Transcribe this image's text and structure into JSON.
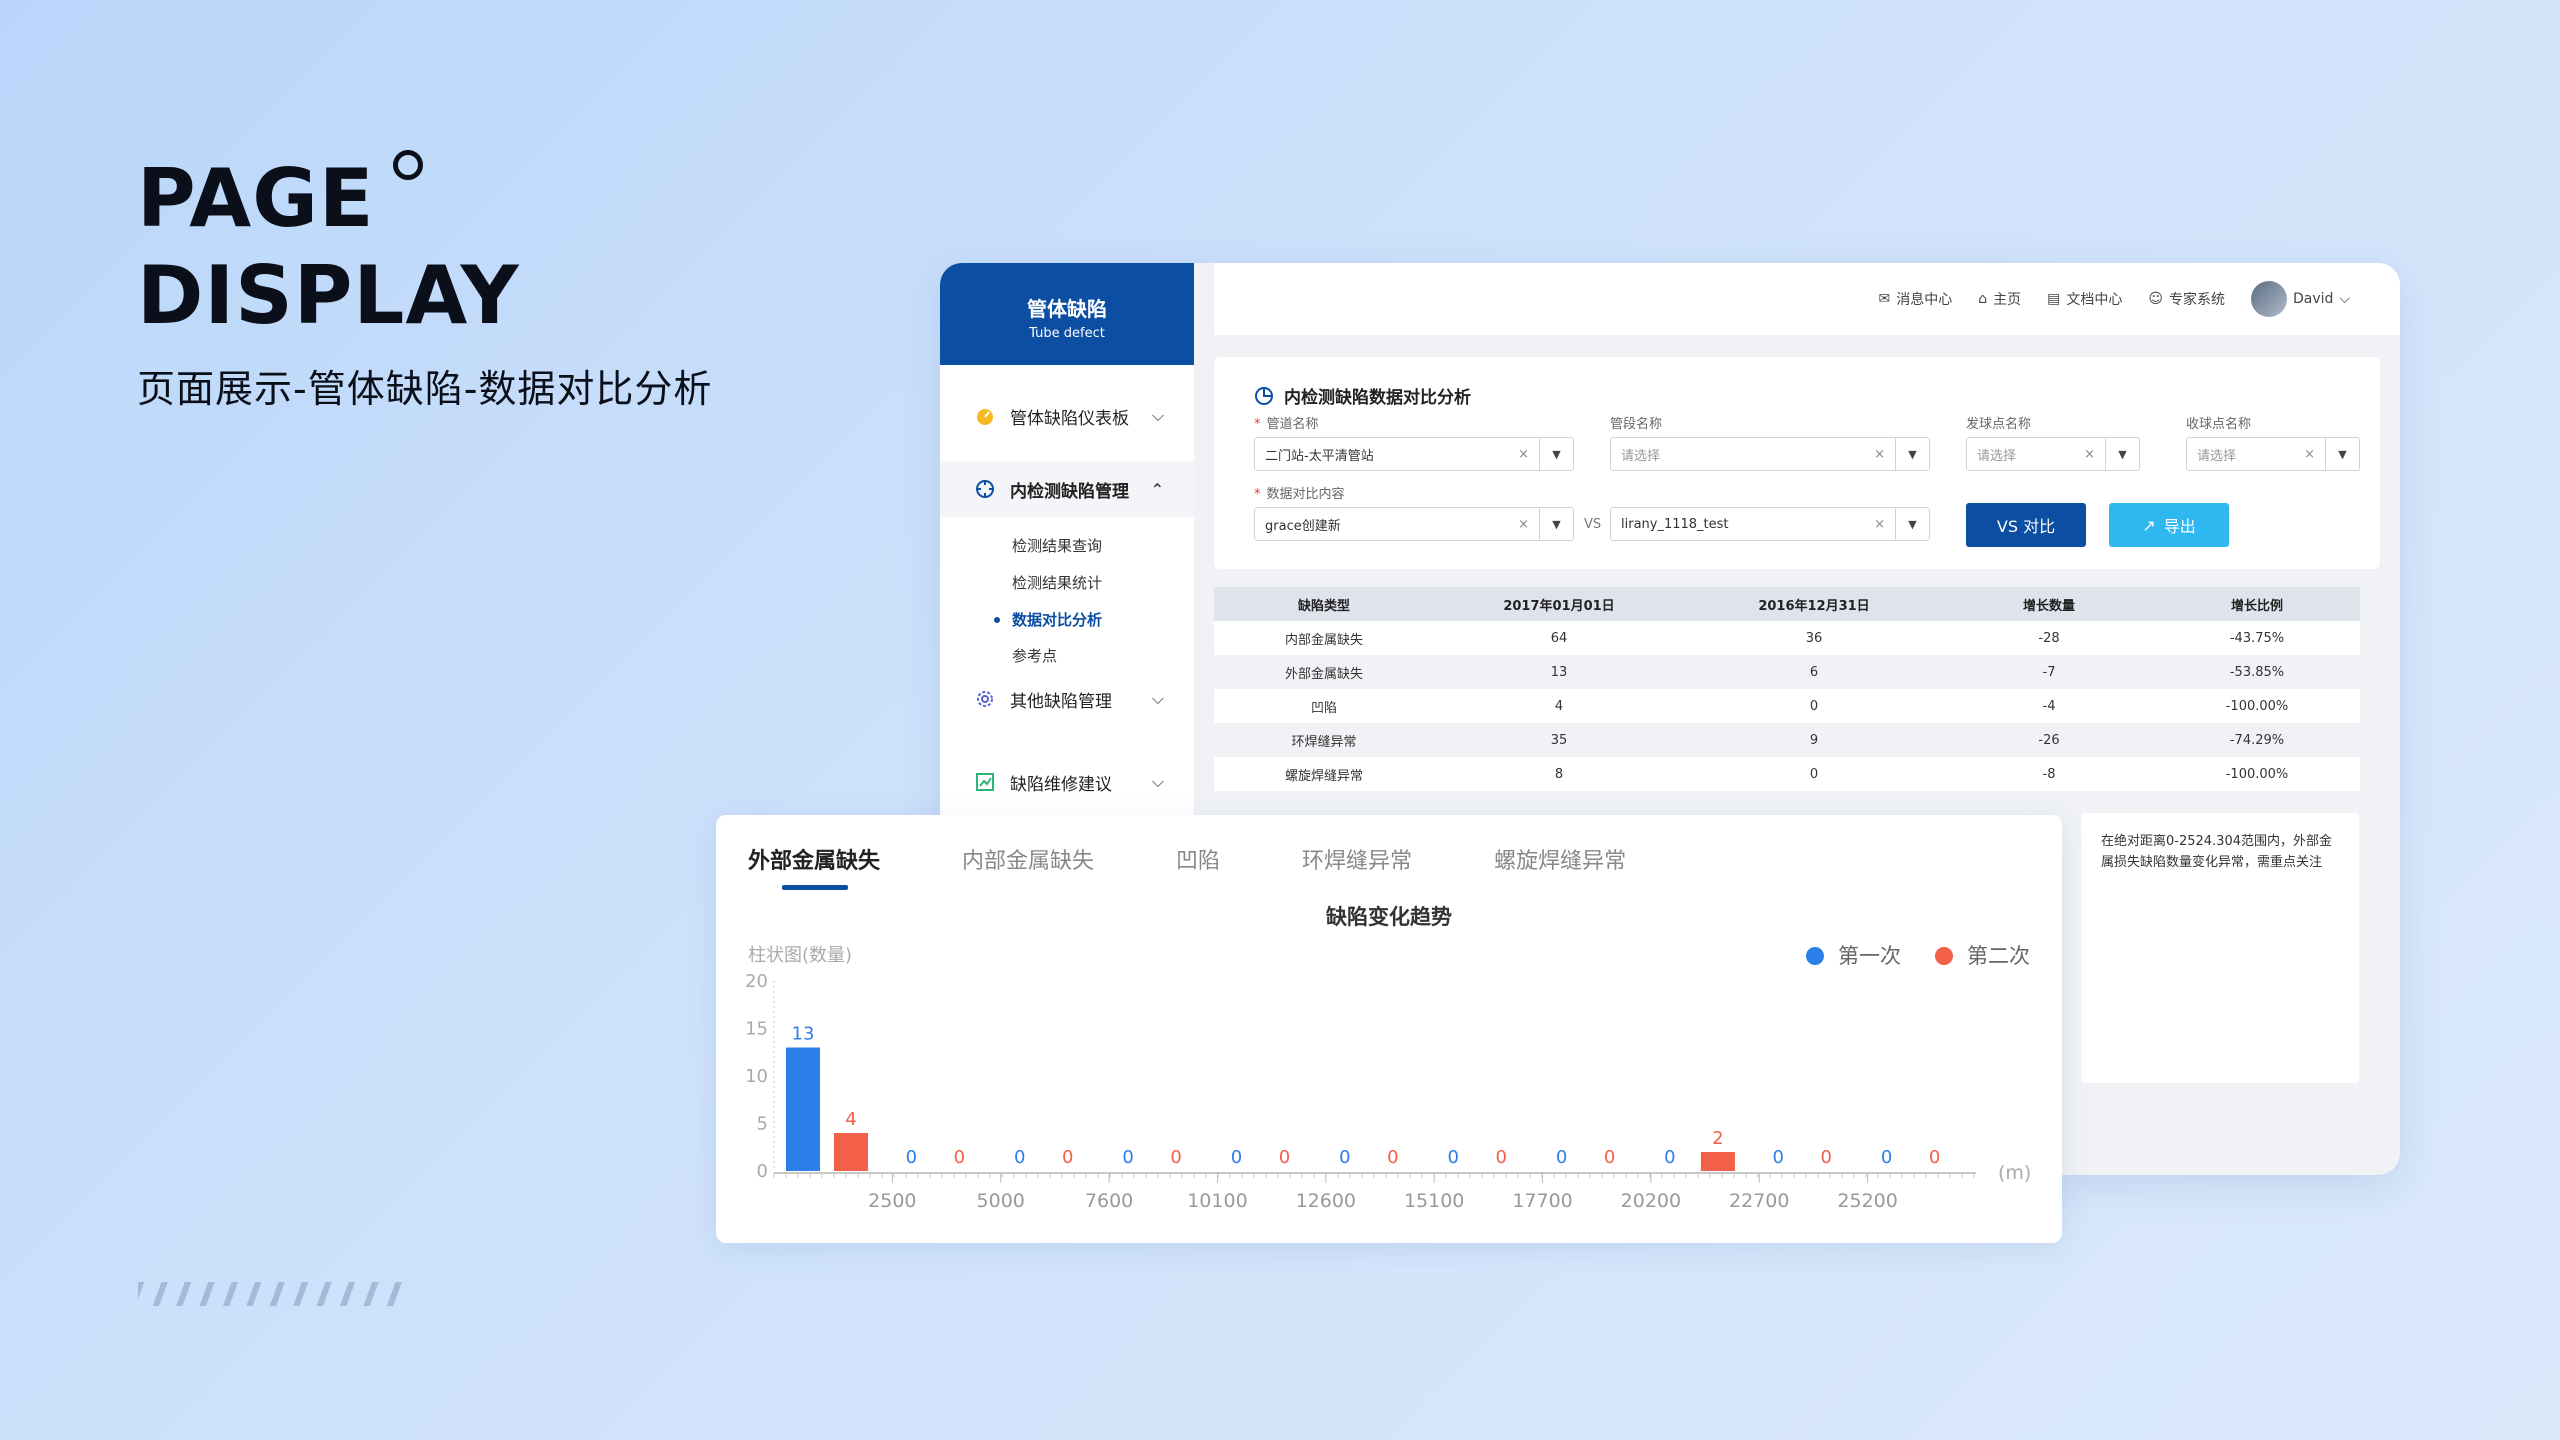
{
  "hero": {
    "line1": "PAGE",
    "line2": "DISPLAY",
    "subtitle": "页面展示-管体缺陷-数据对比分析"
  },
  "brand": {
    "title_cn": "管体缺陷",
    "title_en": "Tube defect"
  },
  "topbar": {
    "items": [
      {
        "icon": "mail-icon",
        "label": "消息中心"
      },
      {
        "icon": "home-icon",
        "label": "主页"
      },
      {
        "icon": "document-icon",
        "label": "文档中心"
      },
      {
        "icon": "user-icon",
        "label": "专家系统"
      }
    ],
    "user": "David"
  },
  "sidebar": {
    "items": [
      {
        "label": "管体缺陷仪表板",
        "icon": "dashboard-icon"
      },
      {
        "label": "内检测缺陷管理",
        "icon": "target-icon"
      },
      {
        "label": "其他缺陷管理",
        "icon": "gear-icon"
      },
      {
        "label": "缺陷维修建议",
        "icon": "chart-icon"
      }
    ],
    "sub_items": [
      "检测结果查询",
      "检测结果统计",
      "数据对比分析",
      "参考点"
    ]
  },
  "filters": {
    "title": "内检测缺陷数据对比分析",
    "pipeline_label": "管道名称",
    "pipeline_value": "二门站-太平清管站",
    "segment_label": "管段名称",
    "segment_placeholder": "请选择",
    "launch_label": "发球点名称",
    "launch_placeholder": "请选择",
    "receive_label": "收球点名称",
    "receive_placeholder": "请选择",
    "content_label": "数据对比内容",
    "left_value": "grace创建新",
    "vs": "VS",
    "right_value": "lirany_1118_test",
    "compare_button": "VS  对比",
    "export_button": "导出"
  },
  "table": {
    "headers": [
      "缺陷类型",
      "2017年01月01日",
      "2016年12月31日",
      "增长数量",
      "增长比例"
    ],
    "rows": [
      [
        "内部金属缺失",
        "64",
        "36",
        "-28",
        "-43.75%"
      ],
      [
        "外部金属缺失",
        "13",
        "6",
        "-7",
        "-53.85%"
      ],
      [
        "凹陷",
        "4",
        "0",
        "-4",
        "-100.00%"
      ],
      [
        "环焊缝异常",
        "35",
        "9",
        "-26",
        "-74.29%"
      ],
      [
        "螺旋焊缝异常",
        "8",
        "0",
        "-8",
        "-100.00%"
      ]
    ]
  },
  "note": "在绝对距离0-2524.304范围内，外部金属损失缺陷数量变化异常，需重点关注",
  "chart_tabs": [
    "外部金属缺失",
    "内部金属缺失",
    "凹陷",
    "环焊缝异常",
    "螺旋焊缝异常"
  ],
  "colors": {
    "first": "#2b7fe8",
    "second": "#f2604a",
    "brand": "#0b4ea2",
    "export": "#2fb8f0"
  },
  "chart_data": {
    "type": "bar",
    "title": "缺陷变化趋势",
    "ylabel": "柱状图(数量)",
    "xlabel": "(m)",
    "ylim": [
      0,
      20
    ],
    "yticks": [
      0,
      5,
      10,
      15,
      20
    ],
    "xtick_labels": [
      "2500",
      "5000",
      "7600",
      "10100",
      "12600",
      "15100",
      "17700",
      "20200",
      "22700",
      "25200"
    ],
    "series": [
      {
        "name": "第一次",
        "values": [
          13,
          0,
          0,
          0,
          0,
          0,
          0,
          0,
          0,
          0,
          0
        ]
      },
      {
        "name": "第二次",
        "values": [
          4,
          0,
          0,
          0,
          0,
          0,
          0,
          0,
          2,
          0,
          0
        ]
      }
    ]
  }
}
